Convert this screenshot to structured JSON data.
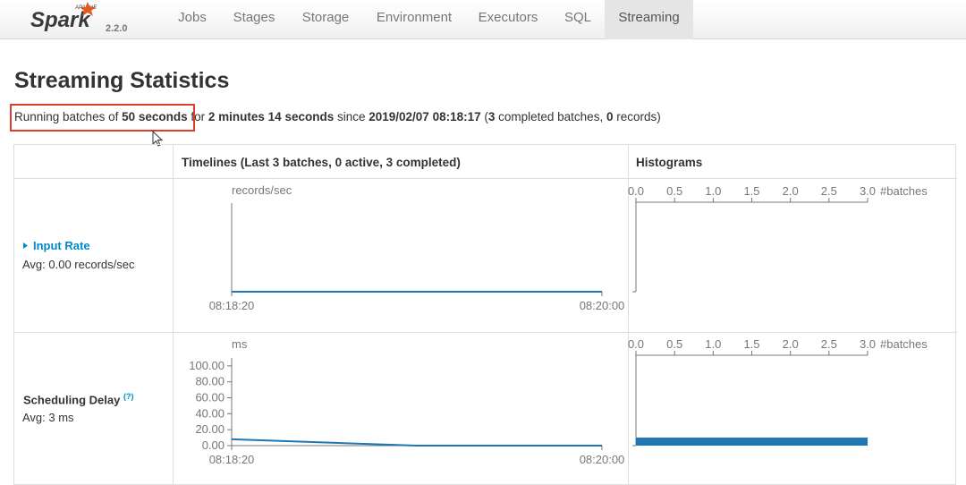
{
  "brand": {
    "apache": "APACHE",
    "name": "Spark",
    "version": "2.2.0"
  },
  "nav": {
    "tabs": [
      {
        "label": "Jobs"
      },
      {
        "label": "Stages"
      },
      {
        "label": "Storage"
      },
      {
        "label": "Environment"
      },
      {
        "label": "Executors"
      },
      {
        "label": "SQL"
      },
      {
        "label": "Streaming",
        "active": true
      }
    ]
  },
  "page": {
    "title": "Streaming Statistics"
  },
  "summary": {
    "prefix": "Running batches of ",
    "batch_interval": "50 seconds",
    "for_text": " for ",
    "duration": "2 minutes 14 seconds",
    "since_text": " since ",
    "start_time": "2019/02/07 08:18:17",
    "open_paren": " (",
    "completed_count": "3",
    "completed_text": " completed batches, ",
    "records_count": "0",
    "records_text": " records)"
  },
  "table": {
    "header_timelines": "Timelines (Last 3 batches, 0 active, 3 completed)",
    "header_histograms": "Histograms"
  },
  "metrics": {
    "input_rate": {
      "name": "Input Rate",
      "avg": "Avg: 0.00 records/sec"
    },
    "scheduling_delay": {
      "name": "Scheduling Delay",
      "help": "(?)",
      "avg": "Avg: 3 ms"
    }
  },
  "chart_data": [
    {
      "type": "line",
      "ylabel": "records/sec",
      "x_ticks": [
        "08:18:20",
        "08:20:00"
      ],
      "x": [
        "08:18:20",
        "08:19:10",
        "08:20:00"
      ],
      "series": [
        {
          "values": [
            0,
            0,
            0
          ]
        }
      ]
    },
    {
      "type": "bar",
      "xlabel": "#batches",
      "x_ticks": [
        "0.0",
        "0.5",
        "1.0",
        "1.5",
        "2.0",
        "2.5",
        "3.0"
      ],
      "values": []
    },
    {
      "type": "line",
      "ylabel": "ms",
      "y_ticks": [
        "100.00",
        "80.00",
        "60.00",
        "40.00",
        "20.00",
        "0.00"
      ],
      "ylim": [
        0,
        110
      ],
      "x_ticks": [
        "08:18:20",
        "08:20:00"
      ],
      "x": [
        "08:18:20",
        "08:19:10",
        "08:20:00"
      ],
      "series": [
        {
          "values": [
            8,
            0,
            0
          ]
        }
      ]
    },
    {
      "type": "bar",
      "xlabel": "#batches",
      "x_ticks": [
        "0.0",
        "0.5",
        "1.0",
        "1.5",
        "2.0",
        "2.5",
        "3.0"
      ],
      "values": [
        3.0
      ]
    }
  ],
  "colors": {
    "accent": "#0088cc",
    "series": "#1f77b4",
    "highlight": "#d9402e"
  }
}
